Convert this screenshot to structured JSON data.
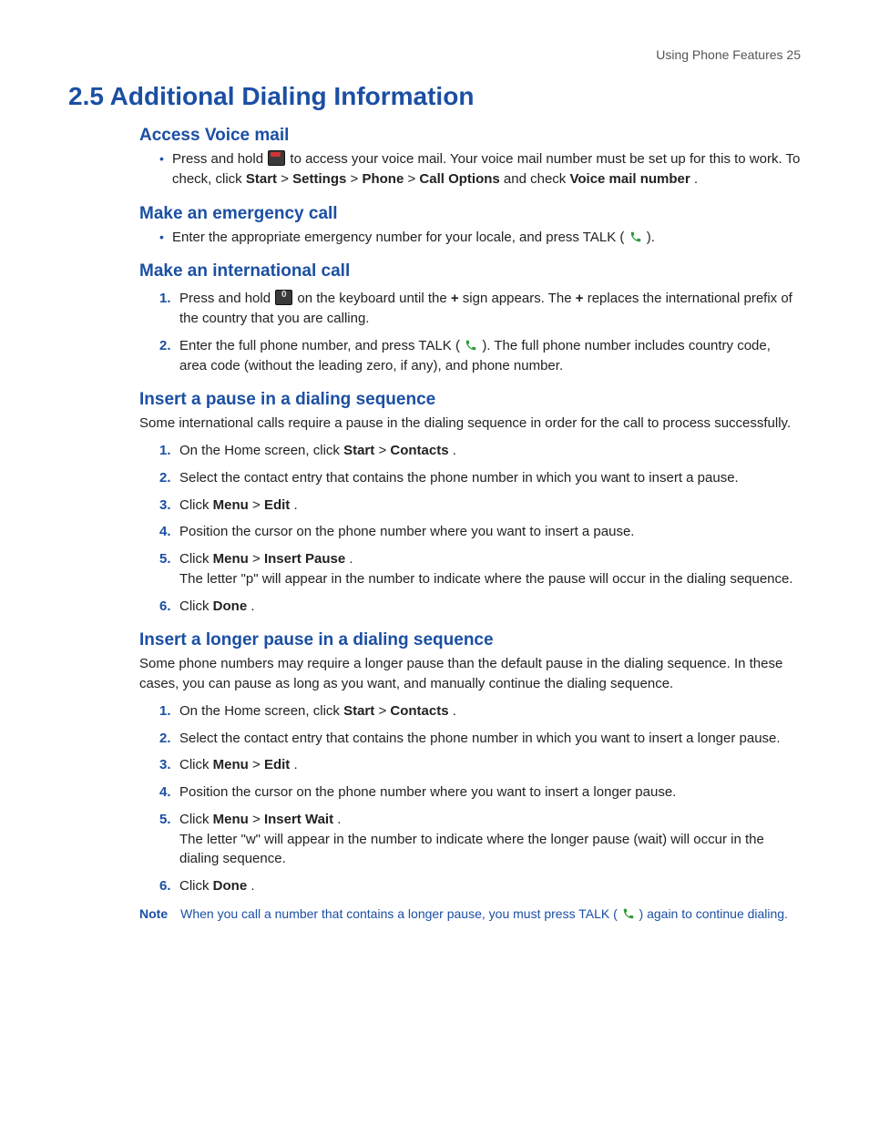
{
  "header": {
    "running": "Using Phone Features  25"
  },
  "title": "2.5  Additional Dialing Information",
  "s1": {
    "heading": "Access Voice mail",
    "b1a": "Press and hold ",
    "b1b": " to access your voice mail. Your voice mail number must be set up for this to work. To check, click ",
    "startLbl": "Start",
    "gt": " > ",
    "settingsLbl": "Settings",
    "phoneLbl": "Phone",
    "callOptLbl": "Call Options",
    "b1c": " and check ",
    "vmLbl": "Voice mail number",
    "period": "."
  },
  "s2": {
    "heading": "Make an emergency call",
    "b1a": "Enter the appropriate emergency number for your locale, and press TALK ( ",
    "b1b": " )."
  },
  "s3": {
    "heading": "Make an international call",
    "l1a": "Press and hold ",
    "l1b": " on the keyboard until the ",
    "plus": "+",
    "l1c": " sign appears. The ",
    "l1d": " replaces the international prefix of the country that you are calling.",
    "l2a": "Enter the full phone number, and press TALK ( ",
    "l2b": " ). The full phone number includes country code, area code (without the leading zero, if any), and phone number."
  },
  "s4": {
    "heading": "Insert a pause in a dialing sequence",
    "intro": "Some international calls require a pause in the dialing sequence in order for the call to process successfully.",
    "l1a": "On the Home screen, click ",
    "start": "Start",
    "gt": " > ",
    "contacts": "Contacts",
    "period": ".",
    "l2": "Select the contact entry that contains the phone number in which you want to insert a pause.",
    "l3a": "Click ",
    "menu": "Menu",
    "edit": "Edit",
    "l4": "Position the cursor on the phone number where you want to insert a pause.",
    "l5a": "Click ",
    "insertPause": "Insert Pause",
    "l5b": "The letter \"p\" will appear in the number to indicate where the pause will occur in the dialing sequence.",
    "l6a": "Click ",
    "done": "Done"
  },
  "s5": {
    "heading": "Insert a longer pause in a dialing sequence",
    "intro": "Some phone numbers may require a longer pause than the default pause in the dialing sequence. In these cases, you can pause as long as you want, and manually continue the dialing sequence.",
    "l1a": "On the Home screen, click ",
    "start": "Start",
    "gt": " > ",
    "contacts": "Contacts",
    "period": ".",
    "l2": "Select the contact entry that contains the phone number in which you want to insert a longer pause.",
    "l3a": "Click ",
    "menu": "Menu",
    "edit": "Edit",
    "l4": "Position the cursor on the phone number where you want to insert a longer pause.",
    "l5a": "Click ",
    "insertWait": "Insert Wait",
    "l5b": "The letter \"w\" will appear in the number to indicate where the longer pause (wait) will occur in the dialing sequence.",
    "l6a": "Click ",
    "done": "Done"
  },
  "note": {
    "label": "Note",
    "a": "When you call a number that contains a longer pause, you must press TALK ( ",
    "b": " ) again to continue dialing."
  }
}
